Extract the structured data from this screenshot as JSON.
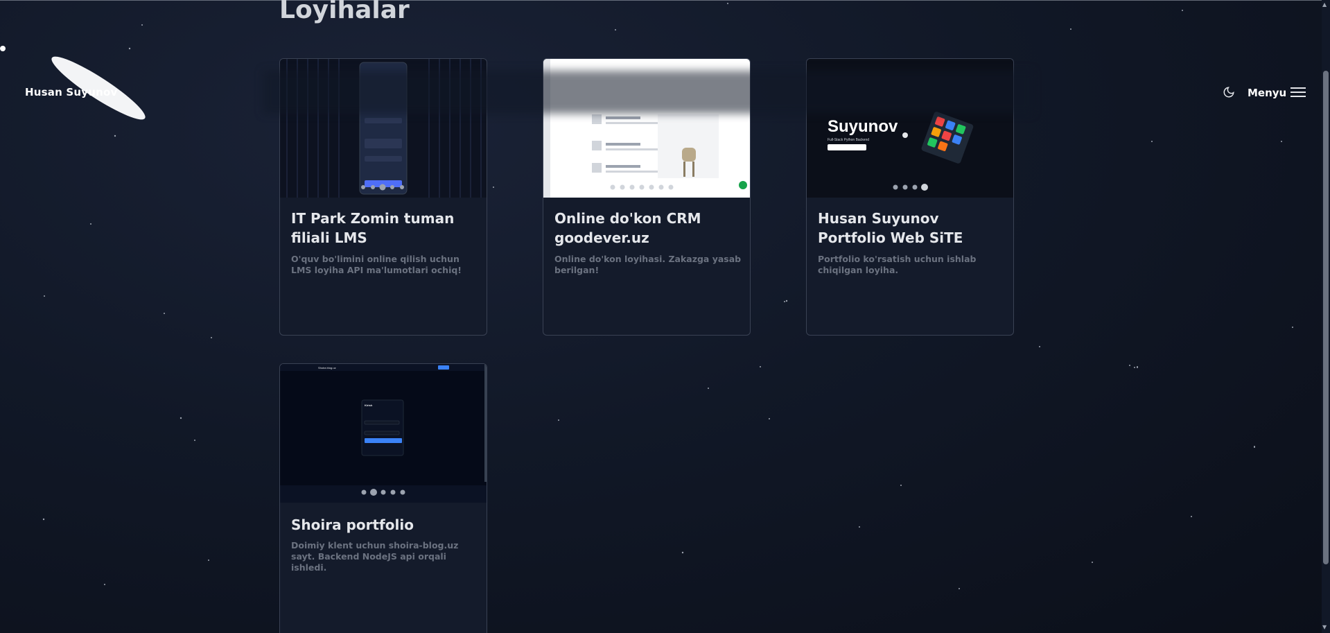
{
  "header": {
    "logo_text": "Husan Suyunov",
    "menu_label": "Menyu",
    "theme_icon": "moon-icon",
    "menu_icon": "hamburger-icon"
  },
  "page": {
    "title": "Loyihalar"
  },
  "projects": [
    {
      "title": "IT Park Zomin tuman filiali LMS",
      "description": "O'quv bo'limini online qilish uchun LMS loyiha API ma'lumotlari ochiq!"
    },
    {
      "title": "Online do'kon CRM goodever.uz",
      "description": "Online do'kon loyihasi. Zakazga yasab berilgan!"
    },
    {
      "title": "Husan Suyunov Portfolio Web SiTE",
      "description": "Portfolio ko'rsatish uchun ishlab chiqilgan loyiha."
    },
    {
      "title": "Shoira portfolio",
      "description": "Doimiy klent uchun shoira-blog.uz sayt. Backend NodeJS api orqali ishledi."
    }
  ],
  "thumbnails": {
    "crm": {
      "items": [
        "Mahsulotlarimiz",
        "Kirimlarimiz",
        "Buyitmalar"
      ]
    },
    "portfolio": {
      "name": "Suyunov",
      "subtitle": "Full-Stack Python Backend",
      "button": "Bog'lanish"
    },
    "shoira": {
      "brand": "Shoira blog.uz",
      "form_title": "Kirish",
      "button": "Kirish"
    }
  },
  "colors": {
    "background": "#111827",
    "card_bg": "#141b2b",
    "card_border": "#3a4254",
    "title": "#e5e7eb",
    "description": "#6b7280",
    "accent_blue": "#4f6ef7"
  }
}
